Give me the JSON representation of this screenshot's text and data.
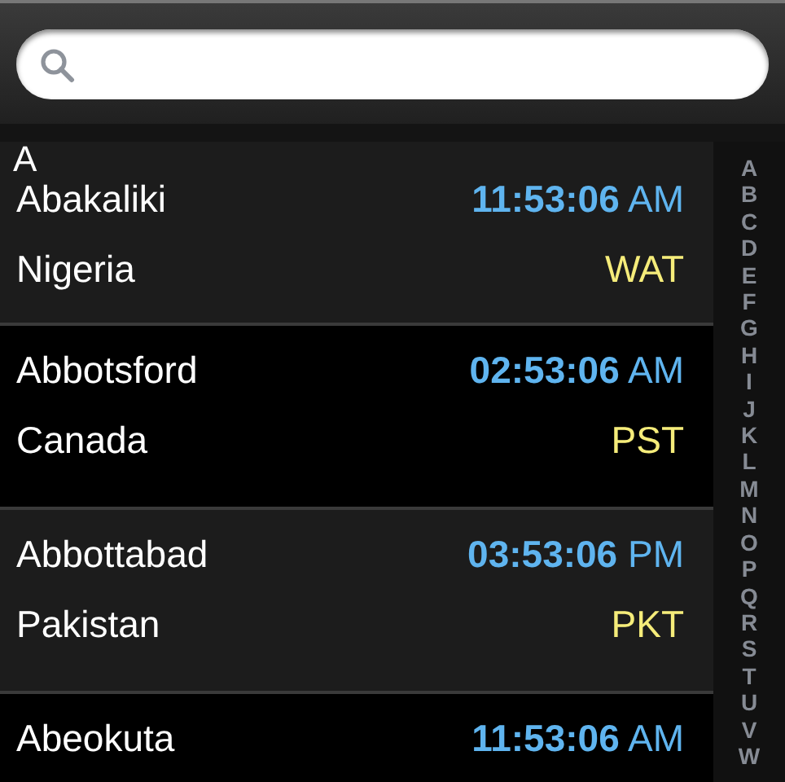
{
  "section_header": "A",
  "rows": [
    {
      "city": "Abakaliki",
      "country": "Nigeria",
      "time": "**11:53:06** AM",
      "zone": "WAT"
    },
    {
      "city": "Abbotsford",
      "country": "Canada",
      "time": "**02:53:06** AM",
      "zone": "PST"
    },
    {
      "city": "Abbottabad",
      "country": "Pakistan",
      "time": "**03:53:06** PM",
      "zone": "PKT"
    },
    {
      "city": "Abeokuta",
      "time": "**11:53:06** AM"
    }
  ],
  "index": [
    "A",
    "B",
    "C",
    "D",
    "E",
    "F",
    "G",
    "H",
    "I",
    "J",
    "K",
    "L",
    "M",
    "N",
    "O",
    "P",
    "Q",
    "R",
    "S",
    "T",
    "U",
    "V",
    "W"
  ]
}
